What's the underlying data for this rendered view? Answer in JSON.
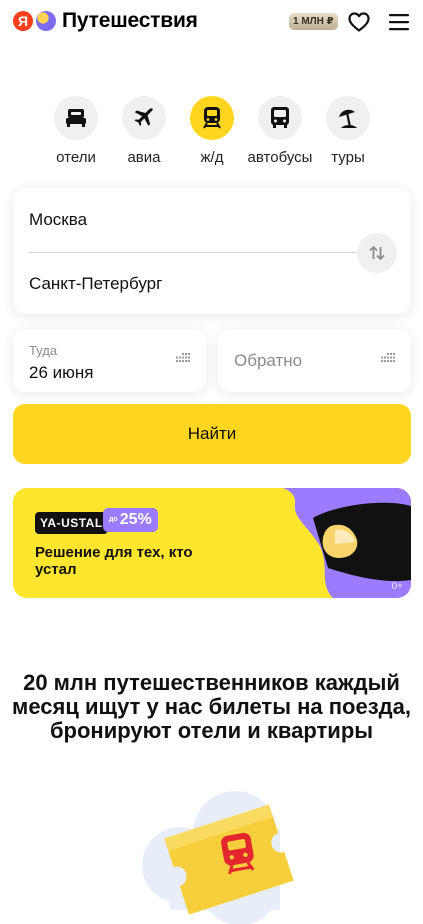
{
  "header": {
    "logo_letter": "Я",
    "title": "Путешествия",
    "plus_badge": "1 МЛН ₽",
    "heart_icon": "heart-icon",
    "menu_icon": "menu-icon"
  },
  "categories": [
    {
      "label": "отели",
      "icon": "bed-icon",
      "active": false
    },
    {
      "label": "авиа",
      "icon": "plane-icon",
      "active": false
    },
    {
      "label": "ж/д",
      "icon": "train-icon",
      "active": true
    },
    {
      "label": "автобусы",
      "icon": "bus-icon",
      "active": false
    },
    {
      "label": "туры",
      "icon": "beach-umbrella-icon",
      "active": false
    }
  ],
  "route": {
    "from": "Москва",
    "to": "Санкт-Петербург"
  },
  "dates": {
    "there_label": "Туда",
    "there_value": "26 июня",
    "back_placeholder": "Обратно"
  },
  "search_button": "Найти",
  "promo": {
    "code": "YA-USTAL",
    "discount_prefix": "до",
    "discount": "25%",
    "text": "Решение для тех, кто устал",
    "age": "0+"
  },
  "tagline": "20 млн путешественников каждый месяц ищут у нас билеты на поезда, бронируют отели и квартиры",
  "colors": {
    "accent": "#ffd51f",
    "promo_yellow": "#ffe62e",
    "promo_purple": "#9b7bff",
    "logo_red": "#fc3f1d",
    "train_red": "#e4262f"
  }
}
